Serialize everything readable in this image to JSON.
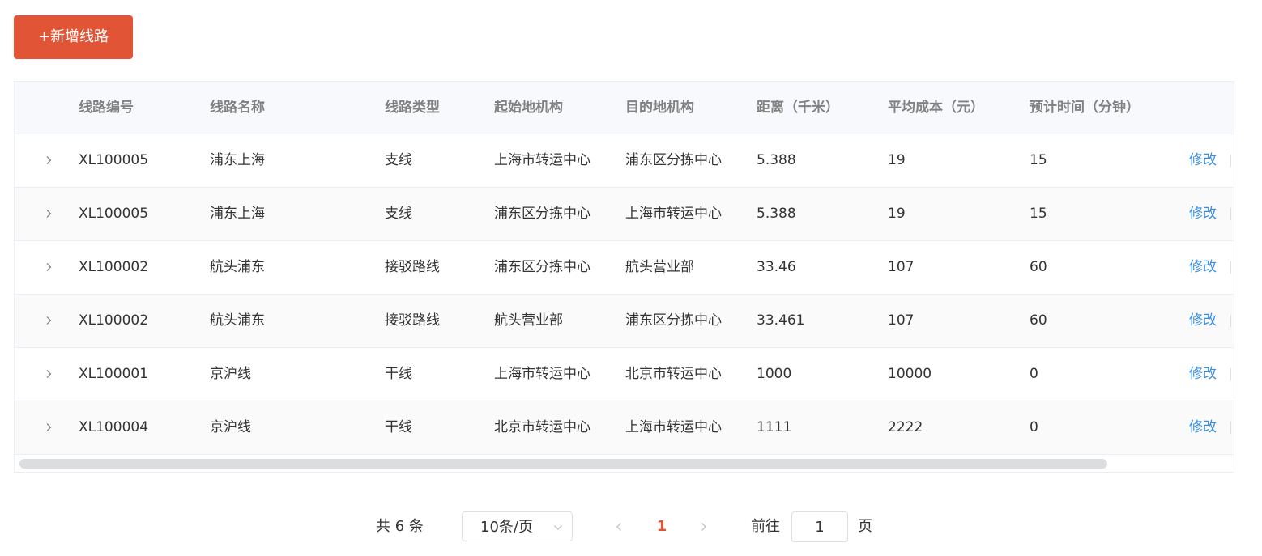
{
  "toolbar": {
    "add_label": "+新增线路"
  },
  "table": {
    "columns": [
      "线路编号",
      "线路名称",
      "线路类型",
      "起始地机构",
      "目的地机构",
      "距离（千米）",
      "平均成本（元）",
      "预计时间（分钟）"
    ],
    "rows": [
      [
        "XL100005",
        "浦东上海",
        "支线",
        "上海市转运中心",
        "浦东区分拣中心",
        "5.388",
        "19",
        "15"
      ],
      [
        "XL100005",
        "浦东上海",
        "支线",
        "浦东区分拣中心",
        "上海市转运中心",
        "5.388",
        "19",
        "15"
      ],
      [
        "XL100002",
        "航头浦东",
        "接驳路线",
        "浦东区分拣中心",
        "航头营业部",
        "33.46",
        "107",
        "60"
      ],
      [
        "XL100002",
        "航头浦东",
        "接驳路线",
        "航头营业部",
        "浦东区分拣中心",
        "33.461",
        "107",
        "60"
      ],
      [
        "XL100001",
        "京沪线",
        "干线",
        "上海市转运中心",
        "北京市转运中心",
        "1000",
        "10000",
        "0"
      ],
      [
        "XL100004",
        "京沪线",
        "干线",
        "北京市转运中心",
        "上海市转运中心",
        "1111",
        "2222",
        "0"
      ]
    ],
    "edit_label": "修改",
    "expand_icon": "chevron-right-icon"
  },
  "pagination": {
    "total_text": "共 6 条",
    "page_size": "10条/页",
    "current_page": "1",
    "goto_label": "前往",
    "goto_value": "1",
    "page_unit": "页"
  },
  "colors": {
    "accent": "#e15536",
    "link": "#3b8ee0",
    "header_bg": "#f8f9fc"
  }
}
